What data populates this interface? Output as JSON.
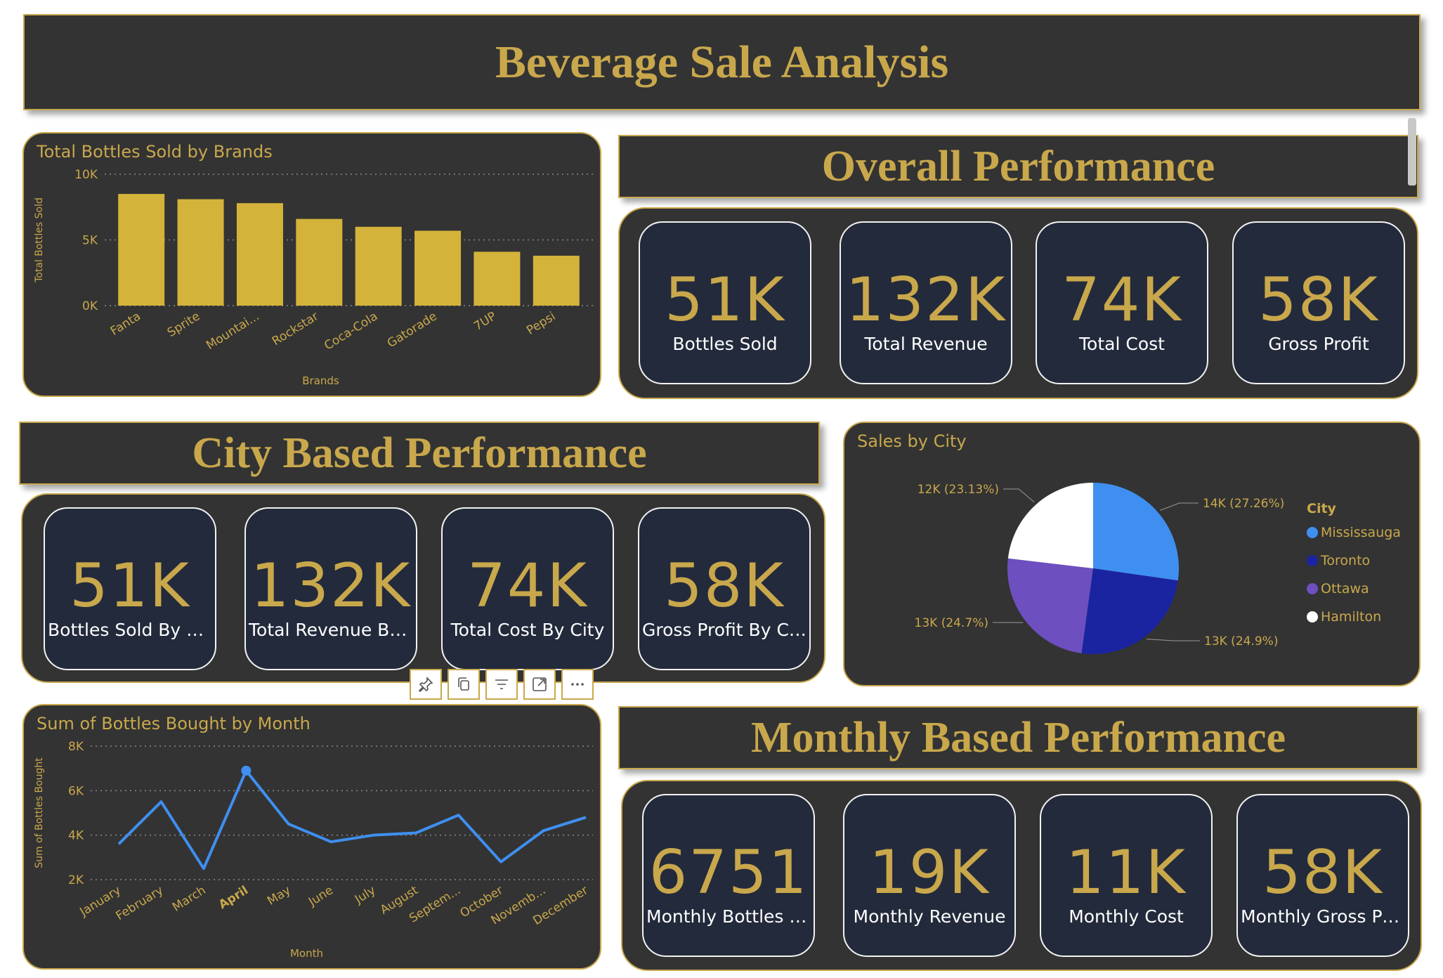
{
  "page_title": "Beverage Sale Analysis",
  "sections": {
    "overall": "Overall Performance",
    "city": "City Based Performance",
    "monthly": "Monthly Based Performance"
  },
  "overall_kpis": [
    {
      "value": "51K",
      "label": "Bottles Sold"
    },
    {
      "value": "132K",
      "label": "Total Revenue"
    },
    {
      "value": "74K",
      "label": "Total Cost"
    },
    {
      "value": "58K",
      "label": "Gross Profit"
    }
  ],
  "city_kpis": [
    {
      "value": "51K",
      "label": "Bottles Sold By City"
    },
    {
      "value": "132K",
      "label": "Total Revenue By City"
    },
    {
      "value": "74K",
      "label": "Total Cost By City"
    },
    {
      "value": "58K",
      "label": "Gross Profit By City"
    }
  ],
  "monthly_kpis": [
    {
      "value": "6751",
      "label": "Monthly Bottles Sold"
    },
    {
      "value": "19K",
      "label": "Monthly Revenue"
    },
    {
      "value": "11K",
      "label": "Monthly Cost"
    },
    {
      "value": "58K",
      "label": "Monthly Gross Pro..."
    }
  ],
  "toolbar_icons": [
    "pin-icon",
    "copy-icon",
    "filter-icon",
    "focus-mode-icon",
    "more-options-icon"
  ],
  "colors": {
    "gold": "#c9a84c",
    "panel_bg": "#333333",
    "card_bg": "#232a3b",
    "bar": "#d4b33a",
    "line": "#3f8ff0"
  },
  "chart_data": [
    {
      "type": "bar",
      "title": "Total Bottles Sold by Brands",
      "xlabel": "Brands",
      "ylabel": "Total Bottles Sold",
      "categories": [
        "Fanta",
        "Sprite",
        "Mountai...",
        "Rockstar",
        "Coca-Cola",
        "Gatorade",
        "7UP",
        "Pepsi"
      ],
      "values": [
        8500,
        8100,
        7800,
        6600,
        6000,
        5700,
        4100,
        3800
      ],
      "yticks": [
        "0K",
        "5K",
        "10K"
      ],
      "ylim": [
        0,
        10000
      ],
      "grid": true
    },
    {
      "type": "pie",
      "title": "Sales by City",
      "legend_title": "City",
      "legend_position": "right",
      "slices": [
        {
          "name": "Mississauga",
          "value": 27.26,
          "label": "14K (27.26%)",
          "color": "#3f8ff0"
        },
        {
          "name": "Toronto",
          "value": 24.9,
          "label": "13K (24.9%)",
          "color": "#1a24a0"
        },
        {
          "name": "Ottawa",
          "value": 24.7,
          "label": "13K (24.7%)",
          "color": "#6d4fc0"
        },
        {
          "name": "Hamilton",
          "value": 23.13,
          "label": "12K (23.13%)",
          "color": "#ffffff"
        }
      ]
    },
    {
      "type": "line",
      "title": "Sum of Bottles Bought by Month",
      "xlabel": "Month",
      "ylabel": "Sum of Bottles Bought",
      "categories": [
        "January",
        "February",
        "March",
        "April",
        "May",
        "June",
        "July",
        "August",
        "Septem...",
        "October",
        "Novemb...",
        "December"
      ],
      "values": [
        3600,
        5500,
        2500,
        6900,
        4500,
        3700,
        4000,
        4100,
        4900,
        2800,
        4200,
        4800
      ],
      "highlight": "April",
      "yticks": [
        "2K",
        "4K",
        "6K",
        "8K"
      ],
      "ylim": [
        2000,
        8000
      ],
      "grid": true
    }
  ]
}
